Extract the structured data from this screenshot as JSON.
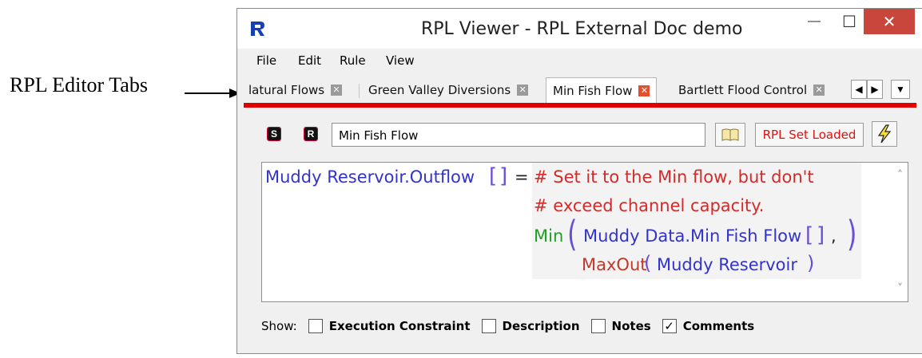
{
  "annotation": {
    "label": "RPL Editor Tabs"
  },
  "window": {
    "title": "RPL Viewer - RPL External Doc demo",
    "close_glyph": "✕",
    "min_glyph": "—",
    "max_glyph": "☐"
  },
  "menu": [
    "File",
    "Edit",
    "Rule",
    "View"
  ],
  "tabs": [
    {
      "label": "latural Flows",
      "active": false
    },
    {
      "label": "Green Valley Diversions",
      "active": false
    },
    {
      "label": "Min Fish Flow",
      "active": true
    },
    {
      "label": "Bartlett Flood Control",
      "active": false
    }
  ],
  "tab_close_glyph": "✕",
  "nav": {
    "prev": "◀",
    "next": "▶",
    "menu": "▼"
  },
  "toolbar": {
    "s_button": "S",
    "r_button": "R",
    "name_value": "Min Fish Flow",
    "status_label": "RPL Set Loaded"
  },
  "editor": {
    "lhs": "Muddy Reservoir.Outflow",
    "bracket_open": "[",
    "bracket_close": "]",
    "equals": "=",
    "comment_line1": "# Set it to the Min flow, but don't",
    "comment_line2": "# exceed channel capacity.",
    "func_min": "Min",
    "arg1": "Muddy Data.Min Fish Flow",
    "comma": ",",
    "func_maxout": "MaxOut",
    "arg2": "Muddy Reservoir",
    "paren_open": "(",
    "paren_close": ")"
  },
  "show": {
    "label": "Show:",
    "options": [
      {
        "label": "Execution Constraint",
        "checked": false
      },
      {
        "label": "Description",
        "checked": false
      },
      {
        "label": "Notes",
        "checked": false
      },
      {
        "label": "Comments",
        "checked": true
      }
    ],
    "check_glyph": "✓"
  },
  "colors": {
    "accent_red": "#e00000",
    "keyword_blue": "#3333cc",
    "comment_red": "#d42a2a",
    "func_green": "#20a020"
  }
}
